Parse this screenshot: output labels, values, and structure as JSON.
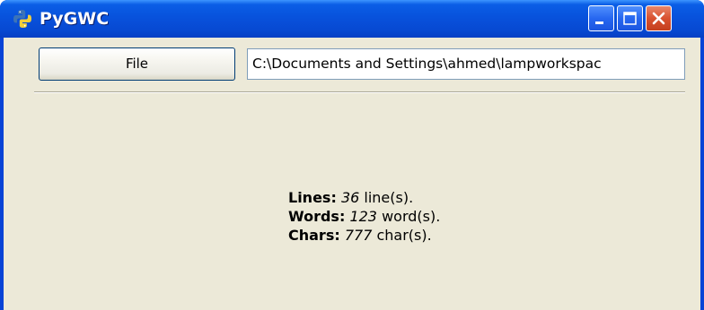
{
  "window": {
    "title": "PyGWC",
    "icon": "python-logo-icon",
    "controls": {
      "minimize": "minimize-icon",
      "maximize": "maximize-icon",
      "close": "close-icon"
    }
  },
  "toolbar": {
    "file_button_label": "File",
    "path_value": "C:\\Documents and Settings\\ahmed\\lampworkspac"
  },
  "stats": {
    "lines_label": "Lines:",
    "lines_value": "36",
    "lines_unit": "line(s).",
    "words_label": "Words:",
    "words_value": "123",
    "words_unit": "word(s).",
    "chars_label": "Chars:",
    "chars_value": "777",
    "chars_unit": "char(s)."
  },
  "colors": {
    "titlebar": "#0a5ee6",
    "client_background": "#ece9d8",
    "close_button": "#d9512f"
  }
}
